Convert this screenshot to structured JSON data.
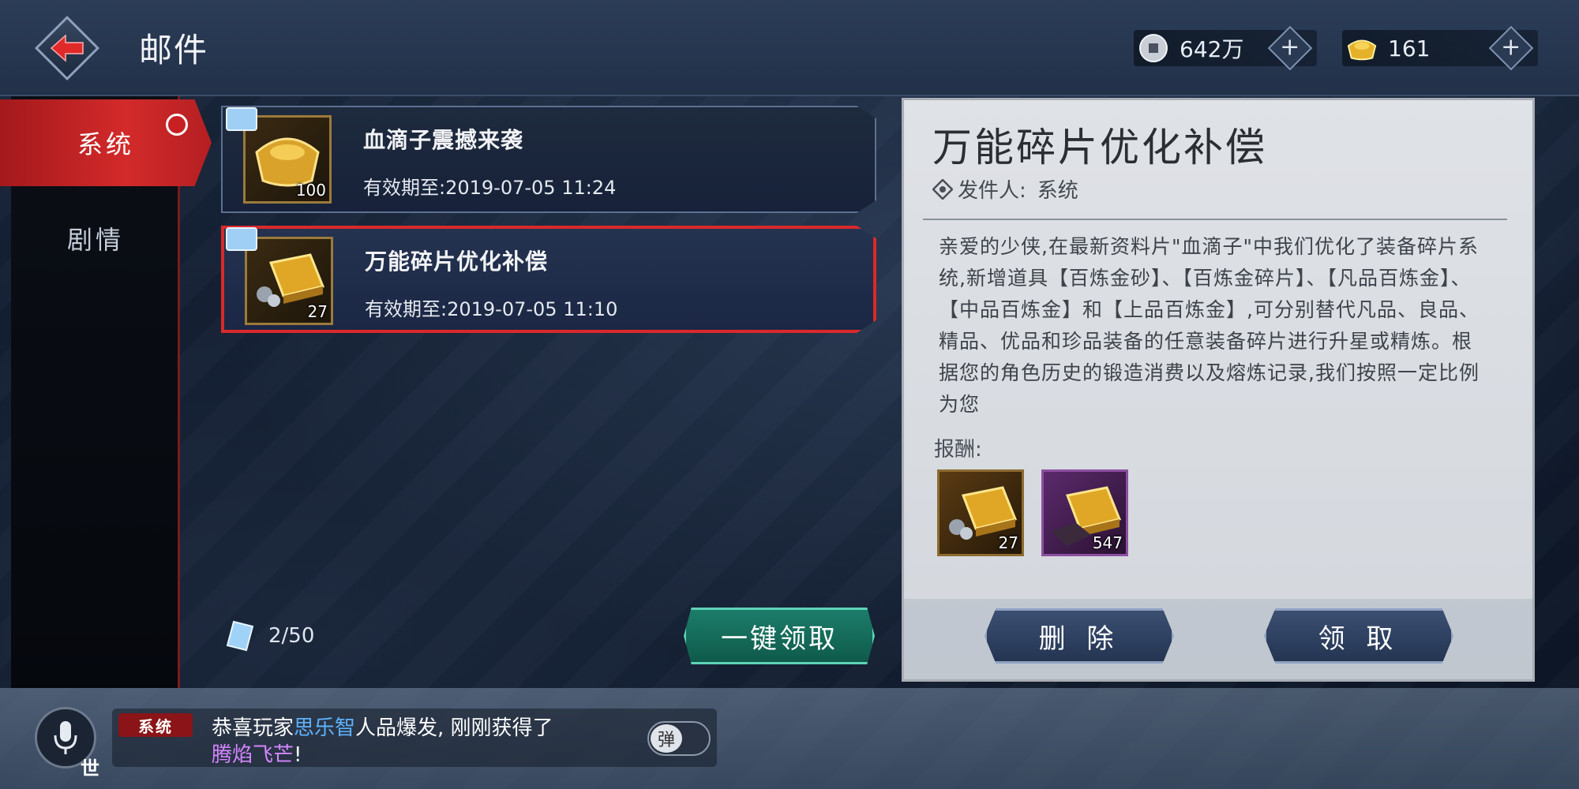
{
  "header": {
    "title": "邮件",
    "currency_coin": "642万",
    "currency_gold": "161"
  },
  "sidebar": {
    "tabs": [
      {
        "label": "系统",
        "active": true
      },
      {
        "label": "剧情",
        "active": false
      }
    ]
  },
  "mail_list": [
    {
      "title": "血滴子震撼来袭",
      "expiry": "有效期至:2019-07-05 11:24",
      "count": "100",
      "selected": false
    },
    {
      "title": "万能碎片优化补偿",
      "expiry": "有效期至:2019-07-05 11:10",
      "count": "27",
      "selected": true
    }
  ],
  "mail_count": "2/50",
  "claim_all_label": "一键领取",
  "detail": {
    "title": "万能碎片优化补偿",
    "sender_label": "发件人:",
    "sender": "系统",
    "body": "亲爱的少侠,在最新资料片\"血滴子\"中我们优化了装备碎片系统,新增道具【百炼金砂】、【百炼金碎片】、【凡品百炼金】、【中品百炼金】和【上品百炼金】,可分别替代凡品、良品、精品、优品和珍品装备的任意装备碎片进行升星或精炼。根据您的角色历史的锻造消费以及熔炼记录,我们按照一定比例为您",
    "reward_label": "报酬:",
    "rewards": [
      {
        "count": "27"
      },
      {
        "count": "547"
      }
    ],
    "delete_label": "删 除",
    "claim_label": "领 取"
  },
  "chat": {
    "channel_badge": "系统",
    "line1_prefix": "恭喜玩家",
    "player_name": "思乐智",
    "line1_suffix": "人品爆发, 刚刚获得了",
    "item_name": "腾焰飞芒",
    "item_suffix": "!",
    "world_label": "世",
    "toggle_label": "弹"
  },
  "colors": {
    "accent_red": "#d32a2a",
    "claim_green": "#1c7d6a",
    "player_blue": "#5eb2ff",
    "item_purple": "#d686ff"
  }
}
